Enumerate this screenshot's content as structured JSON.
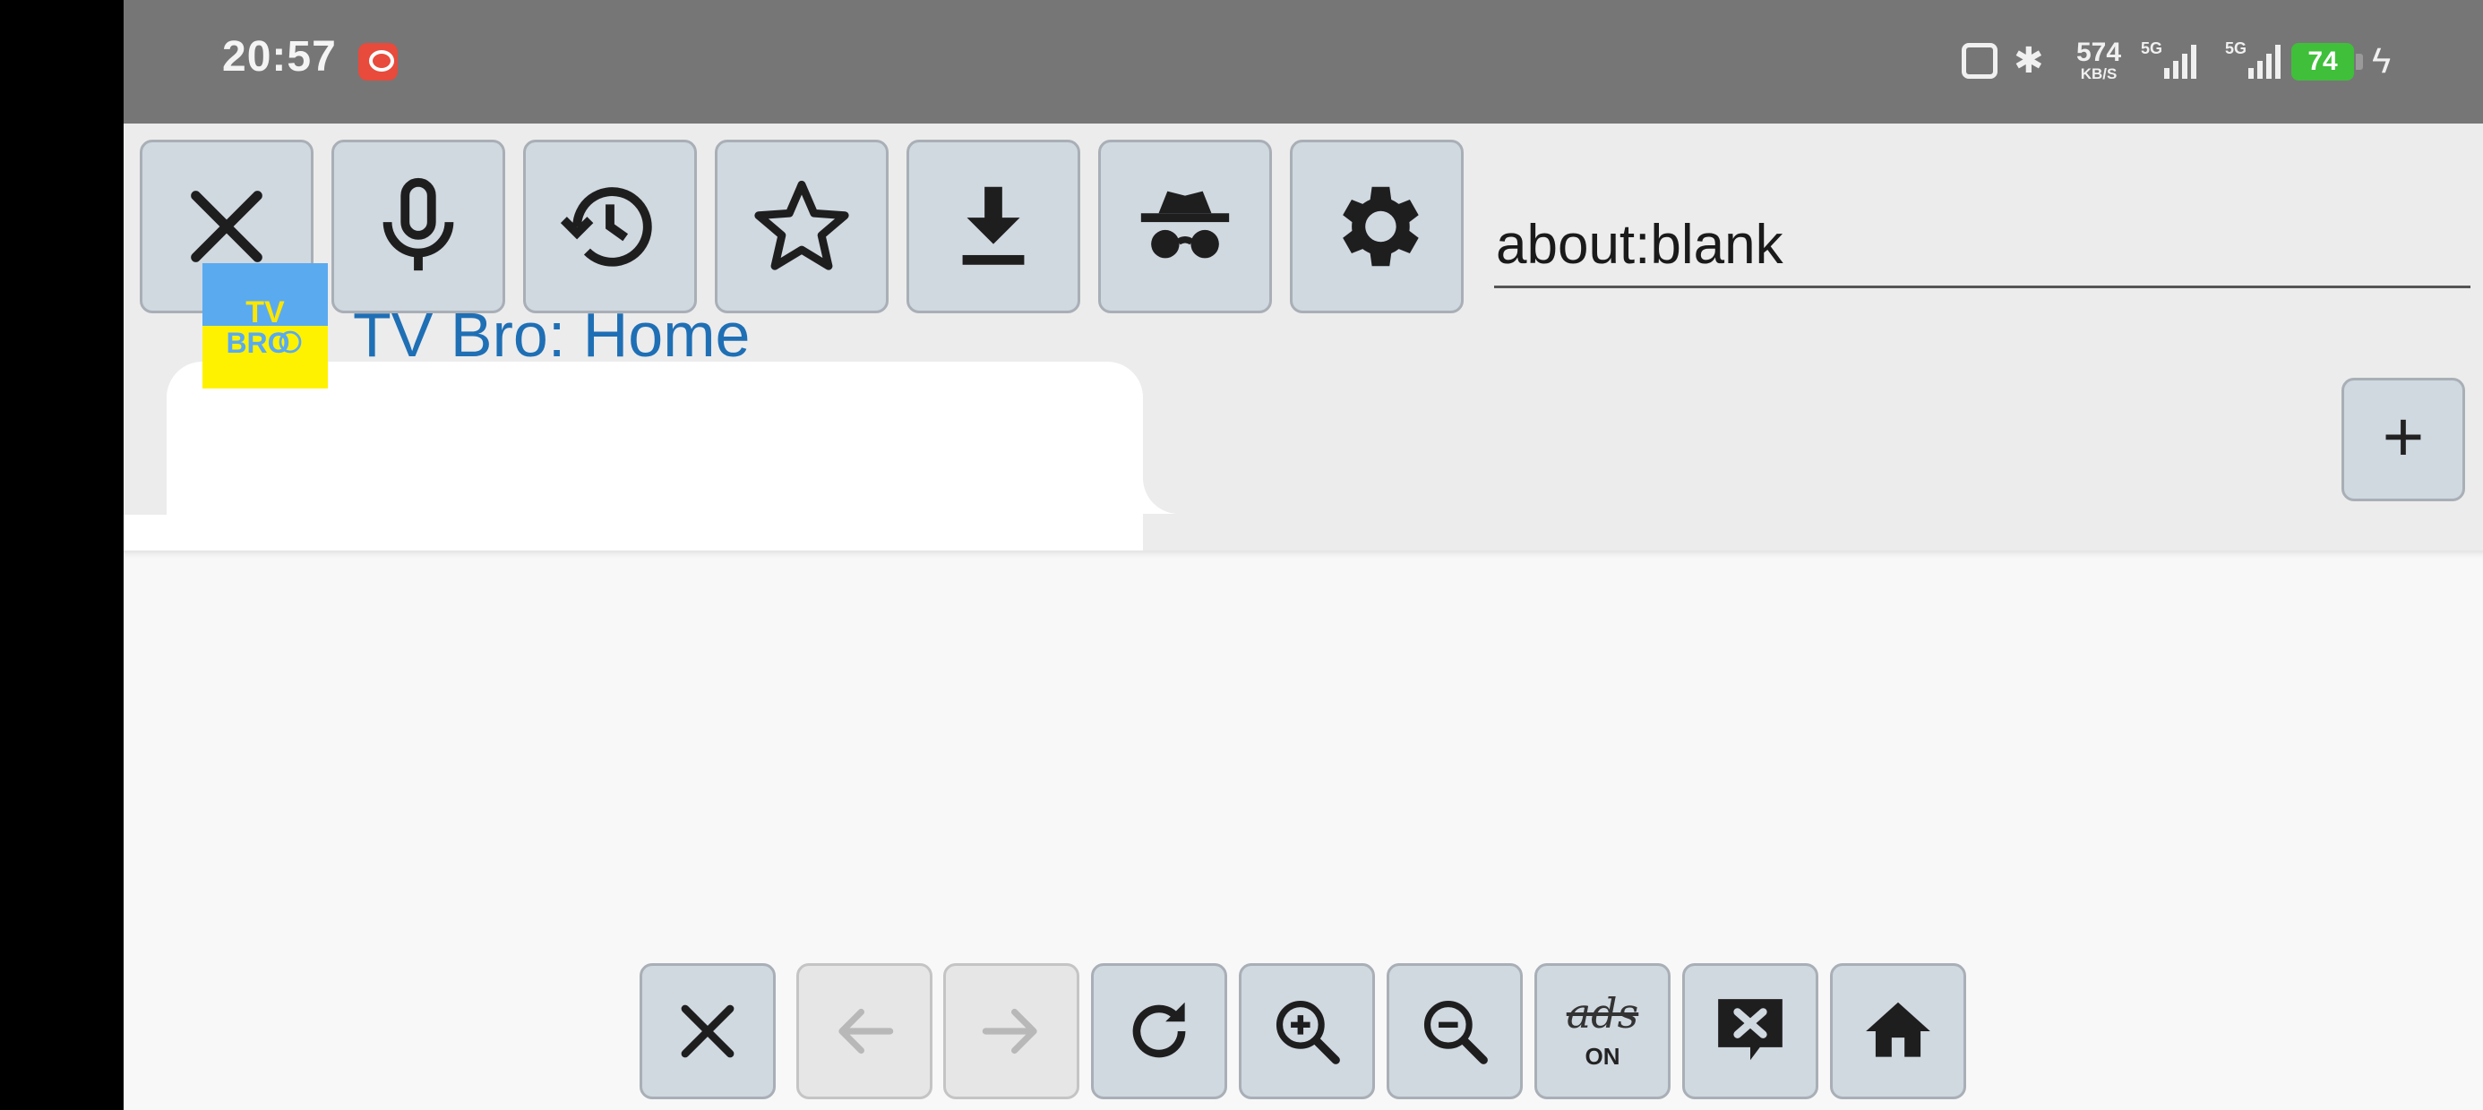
{
  "status_bar": {
    "time": "20:57",
    "network_speed": "574",
    "network_speed_unit": "KB/S",
    "signal_1_label": "5G",
    "signal_2_label": "5G",
    "battery_level": "74"
  },
  "toolbar": {
    "url_value": "about:blank",
    "buttons": [
      "close-icon",
      "microphone-icon",
      "history-icon",
      "star-icon",
      "download-icon",
      "incognito-icon",
      "gear-icon"
    ]
  },
  "tabs": [
    {
      "title": "TV Bro: Home",
      "favicon_text_top": "TV",
      "favicon_text_bottom": "BRO",
      "active": true
    }
  ],
  "new_tab_label": "+",
  "bottom_nav": {
    "ads_label": "ads",
    "ads_state": "ON",
    "back_disabled": true,
    "forward_disabled": true
  },
  "colors": {
    "status_bar": "#767676",
    "toolbar_bg": "#ececec",
    "button_bg": "#d0d8e0",
    "tab_title": "#1f6fb5",
    "battery": "#3fbf3a",
    "favicon_blue": "#5aaaf0",
    "favicon_yellow": "#fff200"
  }
}
